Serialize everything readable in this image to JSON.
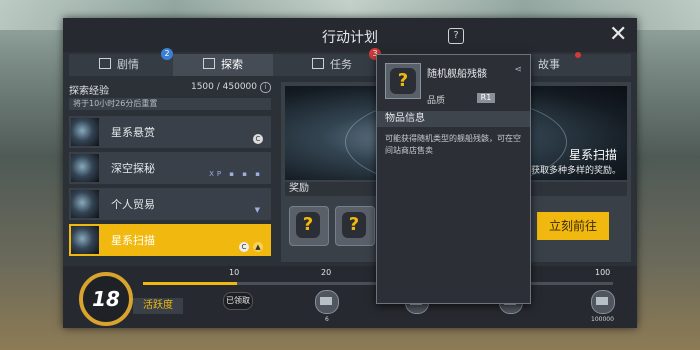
{
  "window": {
    "title": "行动计划",
    "help_icon": "?",
    "close_icon": "✕"
  },
  "tabs": [
    {
      "label": "剧情",
      "badge": "2"
    },
    {
      "label": "探索",
      "active": true
    },
    {
      "label": "任务",
      "badge": "3"
    },
    {
      "label": "故事",
      "dot": true
    }
  ],
  "exploration": {
    "title": "探索经验",
    "value": "1500 / 450000",
    "reset_note": "将于10小时26分后重置",
    "progress": 0.003
  },
  "list": [
    {
      "label": "星系悬赏",
      "extra": "C"
    },
    {
      "label": "深空探秘",
      "extra": "XP ▪ ▪ ▪"
    },
    {
      "label": "个人贸易",
      "extra": "▼"
    },
    {
      "label": "星系扫描",
      "active": true,
      "extra": "C"
    }
  ],
  "detail": {
    "banner_title": "星系扫描",
    "banner_desc": "获取多种多样的奖励。",
    "rewards_label": "奖励",
    "go_button": "立刻前往"
  },
  "activity": {
    "level": "18",
    "label": "活跃度",
    "progress": 0.2,
    "milestones": [
      "10",
      "20",
      "100"
    ],
    "claimed_label": "已领取",
    "node_values": [
      "6",
      "100000"
    ]
  },
  "popup": {
    "name": "随机舰船残骸",
    "quality_label": "品质",
    "rank": "R1",
    "section_title": "物品信息",
    "description": "可能获得随机类型的舰船残骸，可在空间站商店售卖"
  },
  "colors": {
    "accent": "#f1b90f",
    "panel": "#2c3138",
    "badge_blue": "#3c7fd6",
    "badge_red": "#d23a3a"
  }
}
